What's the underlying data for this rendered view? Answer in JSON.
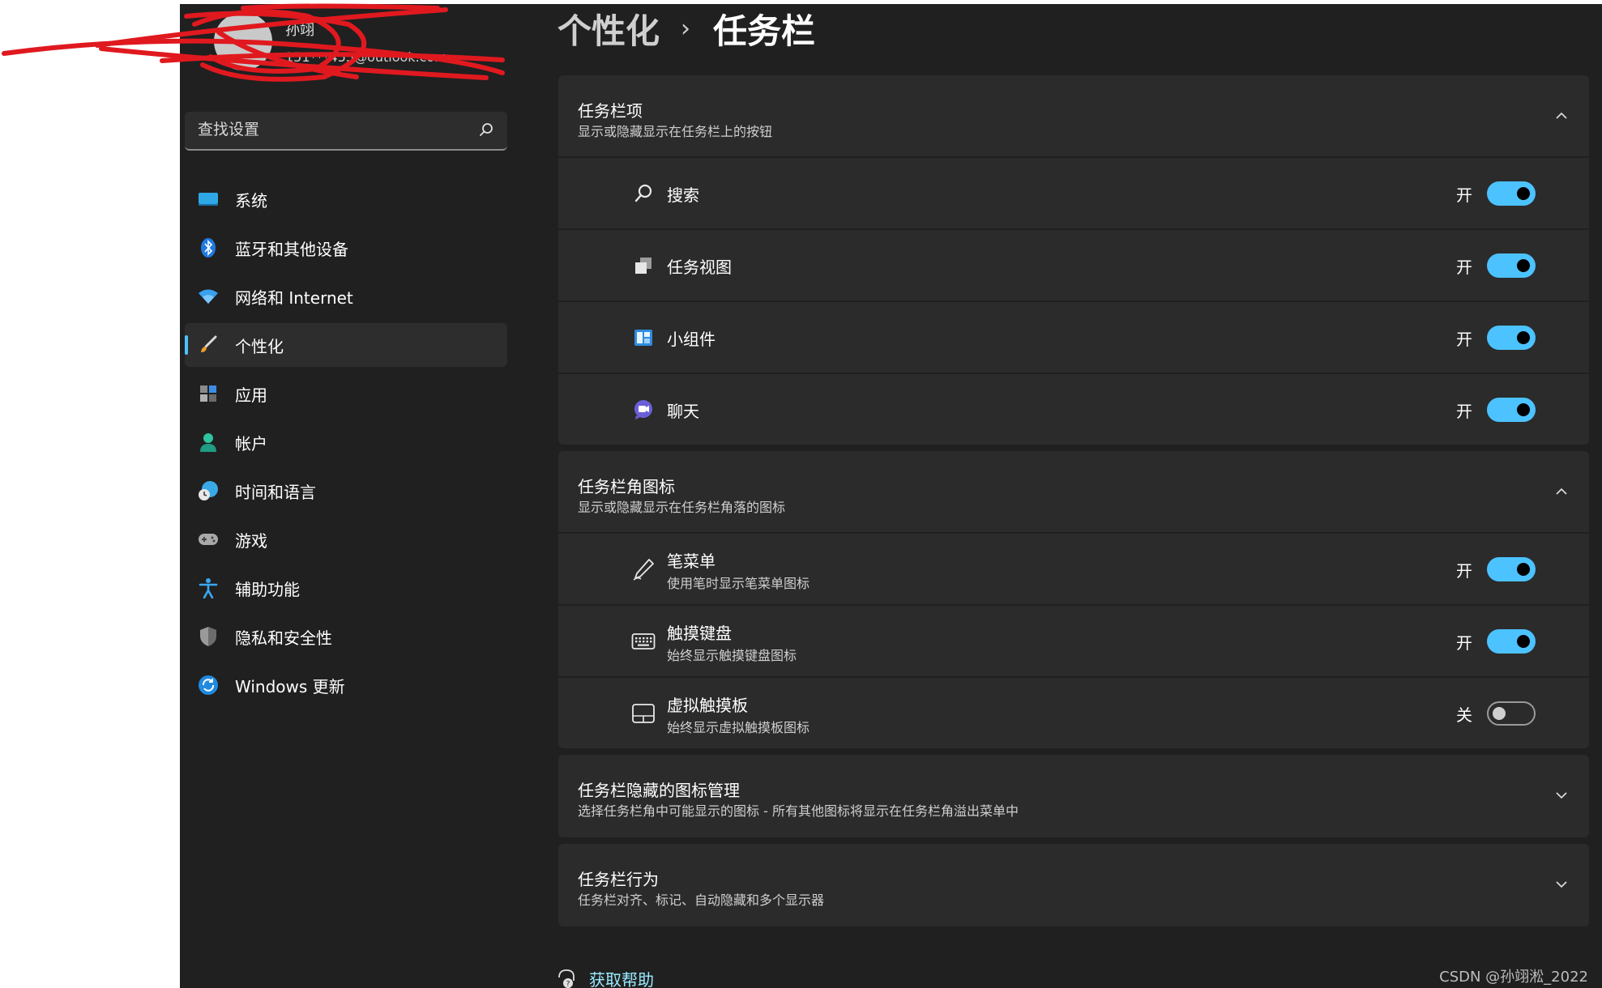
{
  "profile": {
    "name": "孙翊",
    "email": "151***455@outlook.com"
  },
  "search": {
    "placeholder": "查找设置"
  },
  "nav": {
    "items": [
      {
        "label": "系统",
        "icon": "system-icon"
      },
      {
        "label": "蓝牙和其他设备",
        "icon": "bluetooth-icon"
      },
      {
        "label": "网络和 Internet",
        "icon": "wifi-icon"
      },
      {
        "label": "个性化",
        "icon": "brush-icon",
        "active": true
      },
      {
        "label": "应用",
        "icon": "apps-icon"
      },
      {
        "label": "帐户",
        "icon": "account-icon"
      },
      {
        "label": "时间和语言",
        "icon": "clock-globe-icon"
      },
      {
        "label": "游戏",
        "icon": "gamepad-icon"
      },
      {
        "label": "辅助功能",
        "icon": "accessibility-icon"
      },
      {
        "label": "隐私和安全性",
        "icon": "shield-icon"
      },
      {
        "label": "Windows 更新",
        "icon": "update-icon"
      }
    ]
  },
  "breadcrumb": {
    "parent": "个性化",
    "separator": "›",
    "current": "任务栏"
  },
  "sections": {
    "taskbar_items": {
      "title": "任务栏项",
      "subtitle": "显示或隐藏显示在任务栏上的按钮",
      "rows": [
        {
          "label": "搜索",
          "icon": "search-icon",
          "state": "开",
          "on": true
        },
        {
          "label": "任务视图",
          "icon": "task-view-icon",
          "state": "开",
          "on": true
        },
        {
          "label": "小组件",
          "icon": "widgets-icon",
          "state": "开",
          "on": true
        },
        {
          "label": "聊天",
          "icon": "chat-icon",
          "state": "开",
          "on": true
        }
      ]
    },
    "corner_icons": {
      "title": "任务栏角图标",
      "subtitle": "显示或隐藏显示在任务栏角落的图标",
      "rows": [
        {
          "label": "笔菜单",
          "sub": "使用笔时显示笔菜单图标",
          "icon": "pen-icon",
          "state": "开",
          "on": true
        },
        {
          "label": "触摸键盘",
          "sub": "始终显示触摸键盘图标",
          "icon": "keyboard-icon",
          "state": "开",
          "on": true
        },
        {
          "label": "虚拟触摸板",
          "sub": "始终显示虚拟触摸板图标",
          "icon": "touchpad-icon",
          "state": "关",
          "on": false
        }
      ]
    },
    "hidden_icons": {
      "title": "任务栏隐藏的图标管理",
      "subtitle": "选择任务栏角中可能显示的图标 - 所有其他图标将显示在任务栏角溢出菜单中"
    },
    "behaviors": {
      "title": "任务栏行为",
      "subtitle": "任务栏对齐、标记、自动隐藏和多个显示器"
    }
  },
  "help": {
    "label": "获取帮助"
  },
  "watermark": "CSDN @孙翊淞_2022",
  "colors": {
    "accent": "#4cc2ff",
    "background": "#202020",
    "card": "#2b2b2b",
    "link": "#99ebff"
  }
}
